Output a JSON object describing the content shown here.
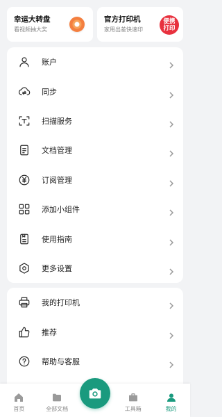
{
  "promos": [
    {
      "title": "幸运大转盘",
      "subtitle": "看视频抽大奖",
      "icon": "lucky-wheel-icon"
    },
    {
      "title": "官方打印机",
      "subtitle": "家用出差快速印",
      "badge_line1": "便携",
      "badge_line2": "打印"
    }
  ],
  "menu_group1": [
    {
      "label": "账户",
      "icon": "person-icon"
    },
    {
      "label": "同步",
      "icon": "cloud-sync-icon"
    },
    {
      "label": "扫描服务",
      "icon": "scan-service-icon"
    },
    {
      "label": "文档管理",
      "icon": "document-icon"
    },
    {
      "label": "订阅管理",
      "icon": "yuan-icon"
    },
    {
      "label": "添加小组件",
      "icon": "widgets-icon"
    },
    {
      "label": "使用指南",
      "icon": "guide-icon"
    },
    {
      "label": "更多设置",
      "icon": "settings-icon"
    }
  ],
  "menu_group2": [
    {
      "label": "我的打印机",
      "icon": "printer-icon"
    },
    {
      "label": "推荐",
      "icon": "thumbs-up-icon"
    },
    {
      "label": "帮助与客服",
      "icon": "help-icon"
    }
  ],
  "tabs": [
    {
      "label": "首页",
      "icon": "home-icon",
      "active": false
    },
    {
      "label": "全部文档",
      "icon": "folder-icon",
      "active": false
    },
    {
      "label": "工具箱",
      "icon": "toolbox-icon",
      "active": false
    },
    {
      "label": "我的",
      "icon": "profile-icon",
      "active": true
    }
  ],
  "colors": {
    "accent": "#1a9a7e",
    "badge_red": "#e8313e",
    "wheel_orange": "#f47f3f"
  }
}
